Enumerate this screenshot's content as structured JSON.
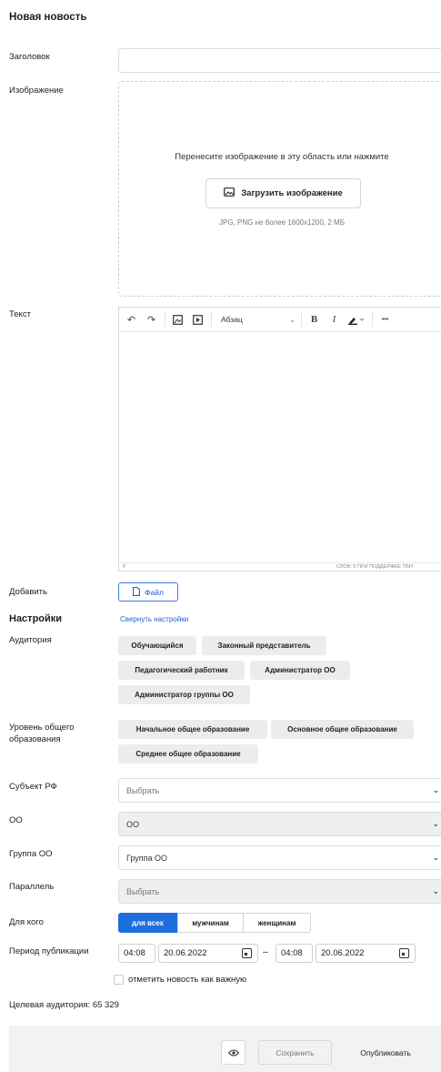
{
  "page": {
    "title": "Новая новость"
  },
  "form": {
    "headline_label": "Заголовок",
    "headline_value": "",
    "image_label": "Изображение",
    "image_drop_text": "Перенесите изображение в эту область или нажмите",
    "image_upload_button": "Загрузить изображение",
    "image_hint": "JPG, PNG не более 1600x1200, 2 МБ",
    "text_label": "Текст",
    "editor": {
      "paragraph_select": "Абзац",
      "bold": "B",
      "italic": "I",
      "more": "•••",
      "status_path": "P",
      "status_right": "СЛОВ: 0  ПРИ ПОДДЕРЖКЕ TINY"
    },
    "add_label": "Добавить",
    "file_button": "Файл"
  },
  "settings": {
    "title": "Настройки",
    "collapse_link": "Свернуть настройки",
    "audience_label": "Аудитория",
    "audience_chips": [
      "Обучающийся",
      "Законный представитель",
      "Педагогический работник",
      "Администратор ОО",
      "Администратор группы ОО"
    ],
    "education_label": "Уровень общего образования",
    "education_chips": [
      "Начальное общее образование",
      "Основное общее образование",
      "Среднее общее образование"
    ],
    "subject_label": "Субъект РФ",
    "subject_value": "Выбрать",
    "oo_label": "ОО",
    "oo_value": "ОО",
    "oo_group_label": "Группа ОО",
    "oo_group_value": "Группа ОО",
    "parallel_label": "Параллель",
    "parallel_value": "Выбрать",
    "for_whom_label": "Для кого",
    "for_whom_options": [
      "для всех",
      "мужчинам",
      "женщинам"
    ],
    "for_whom_selected": "для всех",
    "period_label": "Период публикации",
    "period_start_time": "04:08",
    "period_start_date": "20.06.2022",
    "period_dash": "–",
    "period_end_time": "04:08",
    "period_end_date": "20.06.2022",
    "important_label": "отметить новость как важную",
    "target_audience": "Целевая аудитория: 65 329"
  },
  "footer": {
    "save_button": "Сохранить",
    "publish_button": "Опубликовать"
  },
  "colors": {
    "accent": "#1d6fe0",
    "link": "#1d62d8",
    "chip_bg": "#ececec",
    "footer_bg": "#f2f2f2"
  }
}
